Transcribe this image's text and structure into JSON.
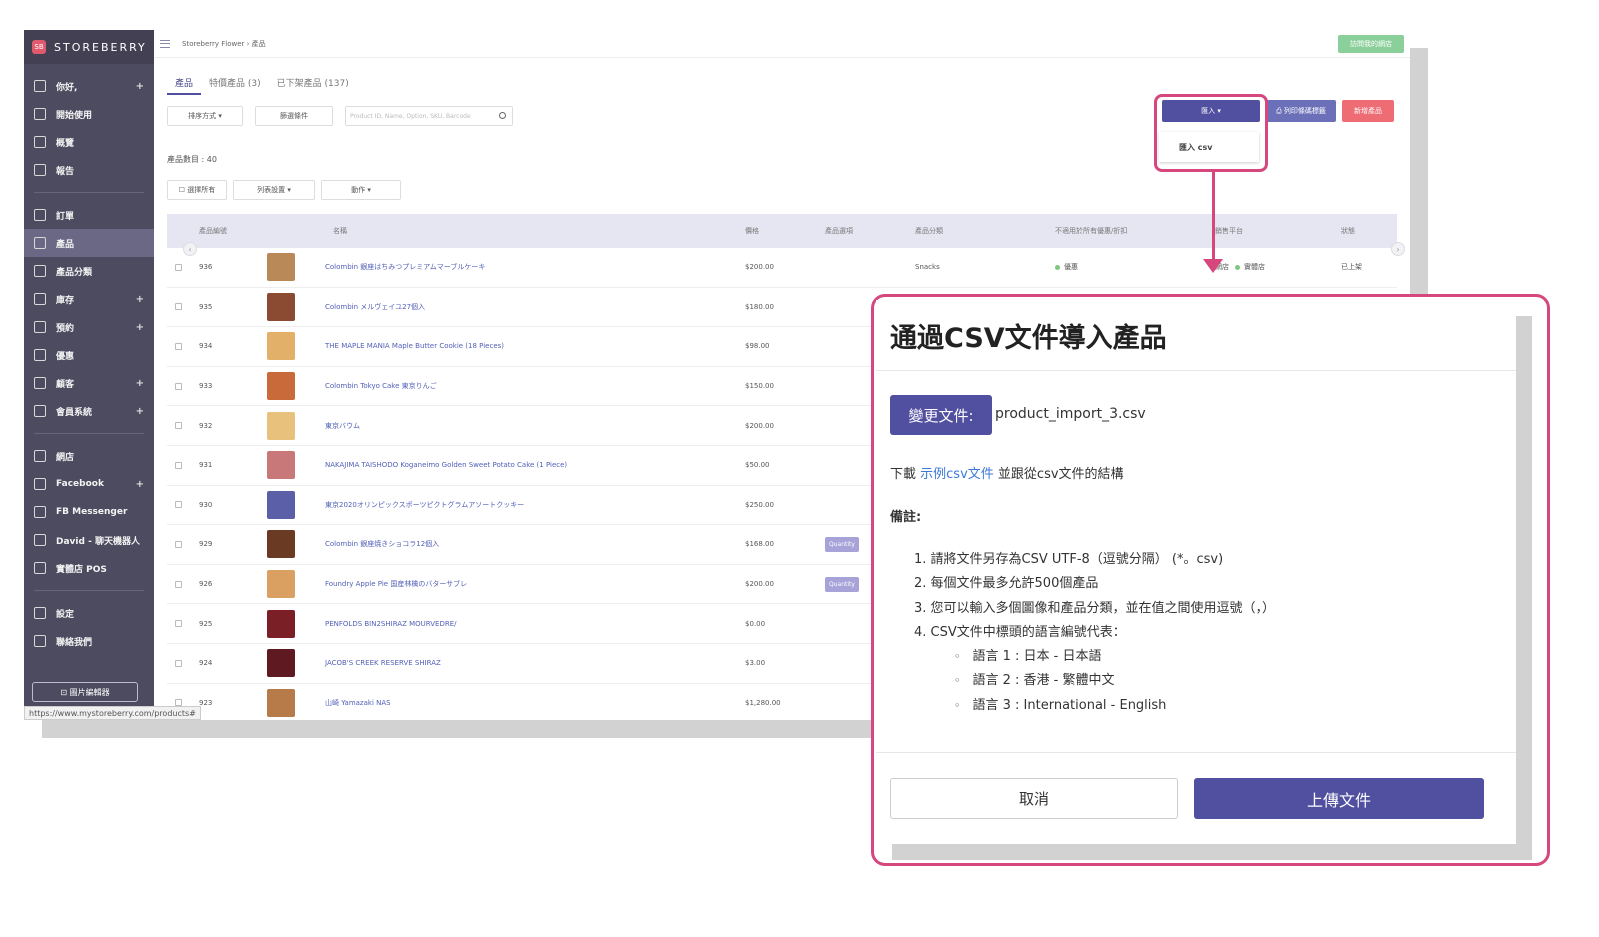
{
  "brand": {
    "name": "STOREBERRY",
    "logo_text": "SB"
  },
  "breadcrumb": "Storeberry Flower › 產品",
  "visit_store_label": "訪問我的網店",
  "sidebar": {
    "items": [
      {
        "label": "你好,",
        "plus": "+"
      },
      {
        "label": "開始使用",
        "plus": ""
      },
      {
        "label": "概覽",
        "plus": ""
      },
      {
        "label": "報告",
        "plus": ""
      },
      {
        "label": "訂單",
        "plus": ""
      },
      {
        "label": "產品",
        "plus": ""
      },
      {
        "label": "產品分類",
        "plus": ""
      },
      {
        "label": "庫存",
        "plus": "+"
      },
      {
        "label": "預約",
        "plus": "+"
      },
      {
        "label": "優惠",
        "plus": ""
      },
      {
        "label": "顧客",
        "plus": "+"
      },
      {
        "label": "會員系統",
        "plus": "+"
      },
      {
        "label": "網店",
        "plus": ""
      },
      {
        "label": "Facebook",
        "plus": "+"
      },
      {
        "label": "FB Messenger",
        "plus": ""
      },
      {
        "label": "David - 聊天機器人",
        "plus": ""
      },
      {
        "label": "實體店 POS",
        "plus": ""
      },
      {
        "label": "設定",
        "plus": ""
      },
      {
        "label": "聯絡我們",
        "plus": ""
      }
    ],
    "image_editor_label": "⊡ 圖片編輯器"
  },
  "tabs": [
    "產品",
    "特價產品 (3)",
    "已下架產品 (137)"
  ],
  "filters": {
    "sort_label": "排序方式 ▾",
    "filter_label": "篩選條件",
    "search_placeholder": "Product ID, Name, Option, SKU, Barcode"
  },
  "product_count": "產品數目 : 40",
  "bulk_actions": {
    "select_all": "☐ 選擇所有",
    "list_settings": "列表設置 ▾",
    "actions": "動作 ▾"
  },
  "top_actions": {
    "import_label": "匯入 ▾",
    "print_label": "⎙ 列印條碼標籤",
    "new_label": "新增產品"
  },
  "import_dropdown": {
    "item": "匯入 csv"
  },
  "table": {
    "headers": [
      "產品編號",
      "名稱",
      "價格",
      "產品選項",
      "產品分類",
      "不適用於所有優惠/折扣",
      "銷售平台",
      "狀態"
    ],
    "rows": [
      {
        "id": "936",
        "name": "Colombin 銀座はちみつプレミアムマーブルケーキ",
        "price": "$200.00",
        "option": "",
        "category": "Snacks",
        "discount": "優惠",
        "platform": "網店",
        "platform2": "實體店",
        "status": "已上架",
        "thumb": "#b98a58"
      },
      {
        "id": "935",
        "name": "Colombin メルヴェイユ27個入",
        "price": "$180.00",
        "option": "",
        "category": "",
        "discount": "",
        "platform": "",
        "platform2": "",
        "status": "",
        "thumb": "#8b4a32"
      },
      {
        "id": "934",
        "name": "THE MAPLE MANIA Maple Butter Cookie (18 Pieces)",
        "price": "$98.00",
        "option": "",
        "category": "",
        "discount": "",
        "platform": "",
        "platform2": "",
        "status": "",
        "thumb": "#e3b06a"
      },
      {
        "id": "933",
        "name": "Colombin Tokyo Cake 東京りんご",
        "price": "$150.00",
        "option": "",
        "category": "",
        "discount": "",
        "platform": "",
        "platform2": "",
        "status": "",
        "thumb": "#c86a3a"
      },
      {
        "id": "932",
        "name": "東京バウム",
        "price": "$200.00",
        "option": "",
        "category": "",
        "discount": "",
        "platform": "",
        "platform2": "",
        "status": "",
        "thumb": "#e8c27c"
      },
      {
        "id": "931",
        "name": "NAKAJIMA TAISHODO Koganeimo Golden Sweet Potato Cake (1 Piece)",
        "price": "$50.00",
        "option": "",
        "category": "",
        "discount": "",
        "platform": "",
        "platform2": "",
        "status": "",
        "thumb": "#c9787a"
      },
      {
        "id": "930",
        "name": "東京2020オリンピックスポーツピクトグラムアソートクッキー",
        "price": "$250.00",
        "option": "",
        "category": "",
        "discount": "",
        "platform": "",
        "platform2": "",
        "status": "",
        "thumb": "#5a5fa8"
      },
      {
        "id": "929",
        "name": "Colombin 銀座焼きショコラ12個入",
        "price": "$168.00",
        "option": "Quantity",
        "category": "",
        "discount": "",
        "platform": "",
        "platform2": "",
        "status": "",
        "thumb": "#6a3a22"
      },
      {
        "id": "926",
        "name": "Foundry Apple Pie 国産林檎のバターサブレ",
        "price": "$200.00",
        "option": "Quantity",
        "category": "",
        "discount": "",
        "platform": "",
        "platform2": "",
        "status": "",
        "thumb": "#d9a062"
      },
      {
        "id": "925",
        "name": "PENFOLDS BIN2SHIRAZ MOURVEDRE/",
        "price": "$0.00",
        "option": "",
        "category": "",
        "discount": "",
        "platform": "",
        "platform2": "",
        "status": "",
        "thumb": "#7a1f26"
      },
      {
        "id": "924",
        "name": "JACOB'S CREEK RESERVE SHIRAZ",
        "price": "$3.00",
        "option": "",
        "category": "",
        "discount": "",
        "platform": "",
        "platform2": "",
        "status": "",
        "thumb": "#5e1a20"
      },
      {
        "id": "923",
        "name": "山崎 Yamazaki NAS",
        "price": "$1,280.00",
        "option": "",
        "category": "",
        "discount": "",
        "platform": "",
        "platform2": "",
        "status": "",
        "thumb": "#b77b4a"
      }
    ]
  },
  "status_url": "https://www.mystoreberry.com/products#",
  "modal": {
    "title": "通過CSV文件導入產品",
    "change_file_label": "變更文件:",
    "file_name": "product_import_3.csv",
    "download_prefix": "下載",
    "download_link": "示例csv文件",
    "download_suffix": "並跟從csv文件的結構",
    "notes_label": "備註:",
    "notes": [
      "1. 請將文件另存為CSV UTF-8（逗號分隔） (*。csv)",
      "2. 每個文件最多允許500個產品",
      "3. 您可以輸入多個圖像和產品分類，並在值之間使用逗號（，）",
      "4. CSV文件中標頭的語言編號代表："
    ],
    "subnotes": [
      "語言 1 : 日本 - 日本語",
      "語言 2 : 香港 - 繁體中文",
      "語言 3 : International - English"
    ],
    "cancel_label": "取消",
    "upload_label": "上傳文件"
  },
  "colors": {
    "accent": "#514f9f",
    "highlight": "#d6487d",
    "sidebar": "#4d4b60"
  }
}
